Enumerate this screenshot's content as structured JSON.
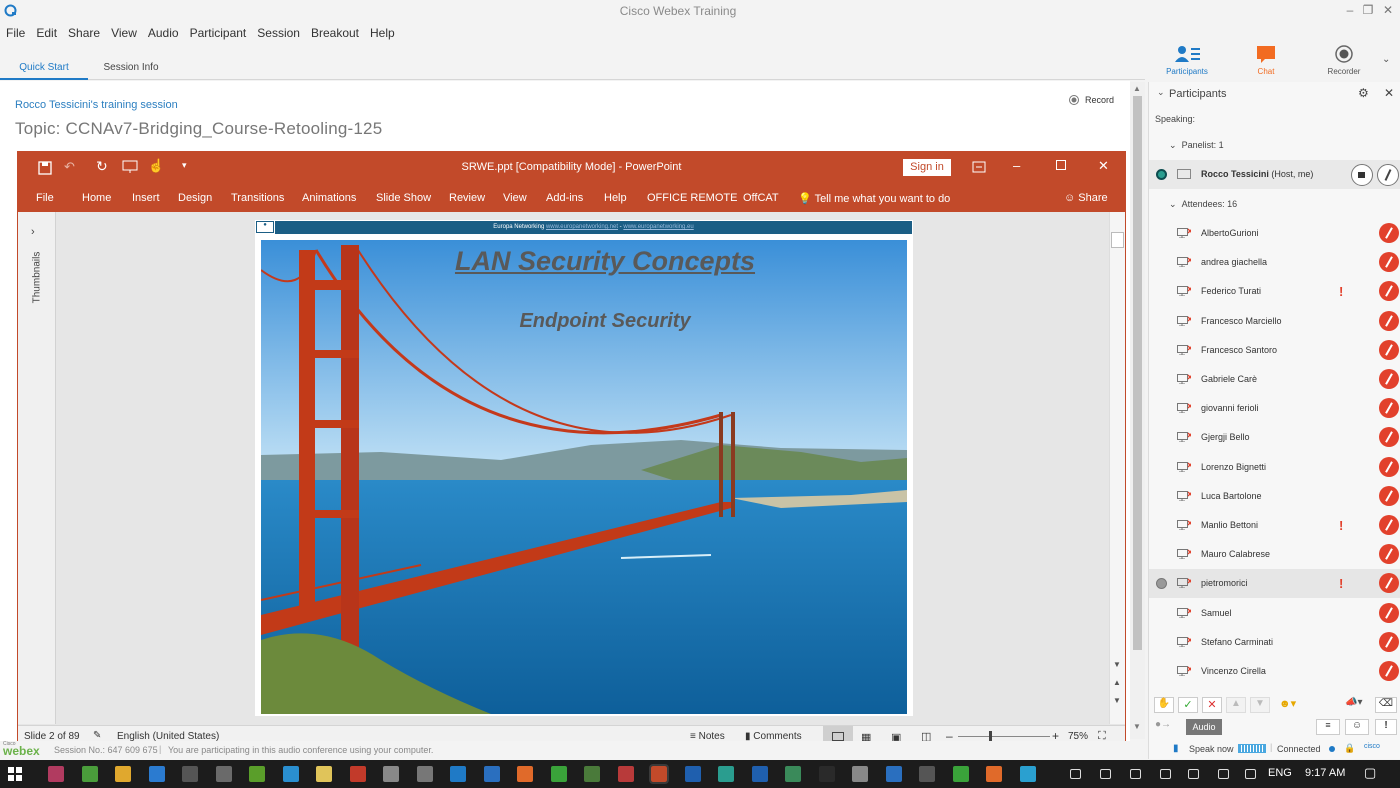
{
  "app": {
    "title": "Cisco Webex Training"
  },
  "menu": [
    "File",
    "Edit",
    "Share",
    "View",
    "Audio",
    "Participant",
    "Session",
    "Breakout",
    "Help"
  ],
  "tabs": [
    {
      "label": "Quick Start",
      "active": true
    },
    {
      "label": "Session Info",
      "active": false
    }
  ],
  "top_right": {
    "participants": "Participants",
    "chat": "Chat",
    "recorder": "Recorder"
  },
  "session": {
    "name": "Rocco Tessicini's training session",
    "topic": "Topic:  CCNAv7-Bridging_Course-Retooling-125",
    "record": "Record"
  },
  "ppt": {
    "title": "SRWE.ppt [Compatibility Mode]  -  PowerPoint",
    "sign_in": "Sign in",
    "ribbon": [
      "File",
      "Home",
      "Insert",
      "Design",
      "Transitions",
      "Animations",
      "Slide Show",
      "Review",
      "View",
      "Add-ins",
      "Help",
      "OFFICE REMOTE",
      "OffCAT"
    ],
    "tell_me": "Tell me what you want to do",
    "share": "Share",
    "thumbnails_label": "Thumbnails",
    "slide": {
      "header_text": "Europa Networking",
      "header_link1": "www.europanetworking.net",
      "header_sep": " - ",
      "header_link2": "www.europanetworking.eu",
      "title": "LAN Security Concepts",
      "subtitle": "Endpoint Security"
    },
    "status": {
      "slide": "Slide 2 of 89",
      "language": "English (United States)",
      "notes": "Notes",
      "comments": "Comments",
      "zoom": "75%"
    }
  },
  "session_bar": {
    "logo_small": "Cisco",
    "logo": "webex",
    "session_no": "Session No.: 647 609 675",
    "audio_msg": "You are participating in this audio conference using your computer."
  },
  "panel": {
    "title": "Participants",
    "speaking": "Speaking:",
    "panelist_header": "Panelist: 1",
    "host_name": "Rocco Tessicini",
    "host_tag": "(Host, me)",
    "attendees_header": "Attendees: 16",
    "attendees": [
      {
        "name": "AlbertoGurioni",
        "alert": false,
        "highlight": false
      },
      {
        "name": "andrea giachella",
        "alert": false,
        "highlight": false
      },
      {
        "name": "Federico Turati",
        "alert": true,
        "highlight": false
      },
      {
        "name": "Francesco Marciello",
        "alert": false,
        "highlight": false
      },
      {
        "name": "Francesco Santoro",
        "alert": false,
        "highlight": false
      },
      {
        "name": "Gabriele Carè",
        "alert": false,
        "highlight": false
      },
      {
        "name": "giovanni ferioli",
        "alert": false,
        "highlight": false
      },
      {
        "name": "Gjergji Bello",
        "alert": false,
        "highlight": false
      },
      {
        "name": "Lorenzo Bignetti",
        "alert": false,
        "highlight": false
      },
      {
        "name": "Luca Bartolone",
        "alert": false,
        "highlight": false
      },
      {
        "name": "Manlio Bettoni",
        "alert": true,
        "highlight": false
      },
      {
        "name": "Mauro Calabrese",
        "alert": false,
        "highlight": false
      },
      {
        "name": "pietromorici",
        "alert": true,
        "highlight": true
      },
      {
        "name": "Samuel",
        "alert": false,
        "highlight": false
      },
      {
        "name": "Stefano Carminati",
        "alert": false,
        "highlight": false
      },
      {
        "name": "Vincenzo Cirella",
        "alert": false,
        "highlight": false
      }
    ],
    "audio_button": "Audio",
    "speak_now": "Speak now",
    "connected": "Connected",
    "cisco": "cisco"
  },
  "taskbar": {
    "lang": "ENG",
    "time": "9:17 AM"
  },
  "colors": {
    "ppt_red": "#c24a2a",
    "webex_blue": "#1f7ac6",
    "chat_orange": "#f26b21",
    "mic_red": "#e2412c"
  }
}
